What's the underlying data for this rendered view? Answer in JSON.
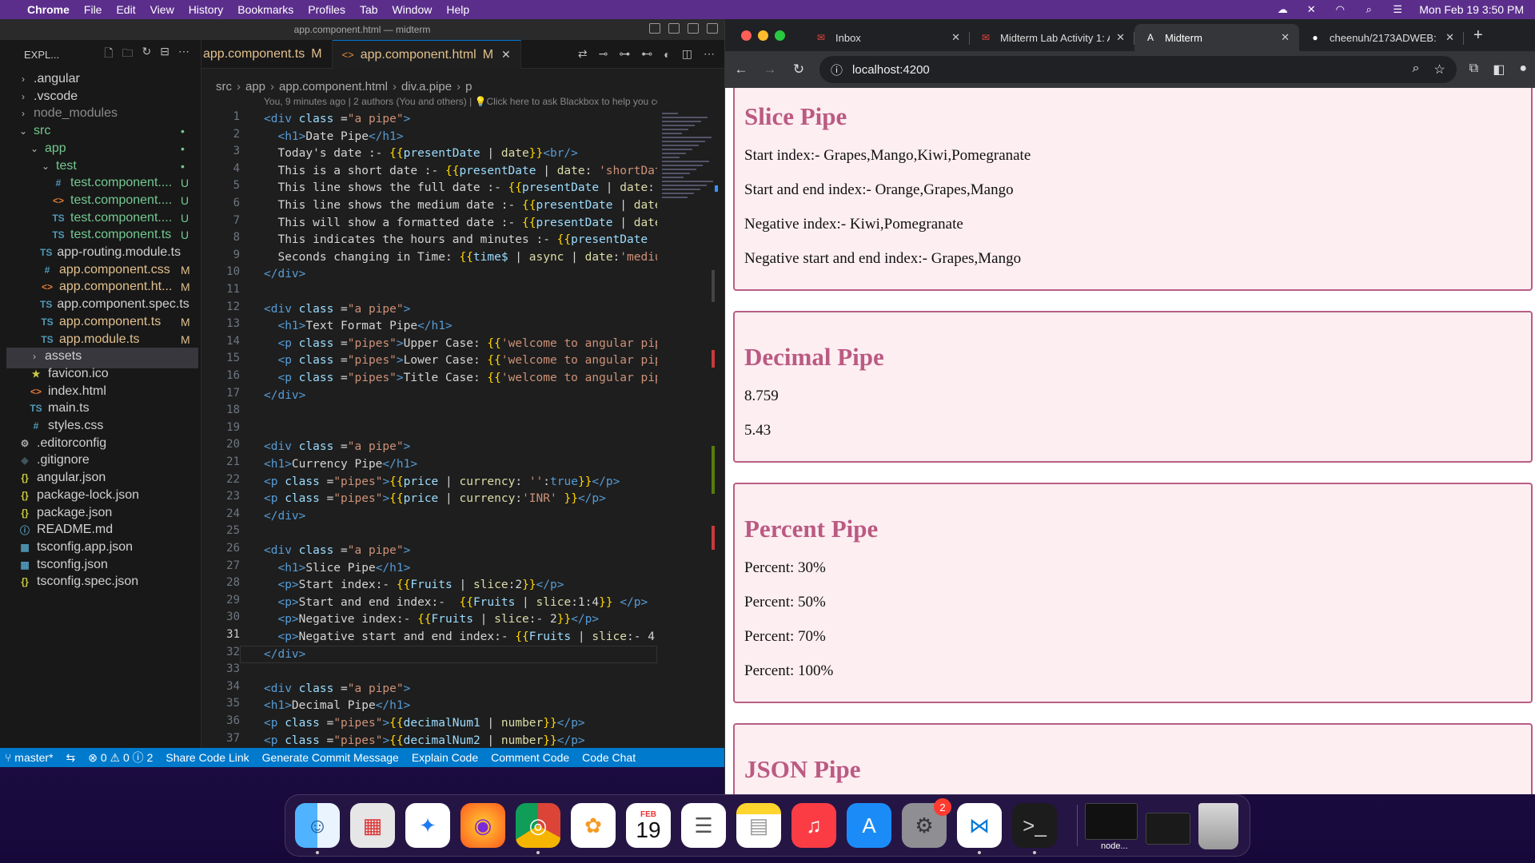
{
  "menubar": {
    "app": "Chrome",
    "items": [
      "File",
      "Edit",
      "View",
      "History",
      "Bookmarks",
      "Profiles",
      "Tab",
      "Window",
      "Help"
    ],
    "datetime": "Mon Feb 19  3:50 PM"
  },
  "vscode": {
    "window_title": "app.component.html — midterm",
    "explorer_label": "EXPL...",
    "tree": [
      {
        "label": ".angular",
        "type": "folder",
        "indent": 1,
        "expanded": false,
        "status": ""
      },
      {
        "label": ".vscode",
        "type": "folder",
        "indent": 1,
        "expanded": false,
        "status": ""
      },
      {
        "label": "node_modules",
        "type": "folder",
        "indent": 1,
        "expanded": false,
        "status": "",
        "dim": true
      },
      {
        "label": "src",
        "type": "folder",
        "indent": 1,
        "expanded": true,
        "status": "•",
        "color": "untracked"
      },
      {
        "label": "app",
        "type": "folder",
        "indent": 2,
        "expanded": true,
        "status": "•",
        "color": "untracked"
      },
      {
        "label": "test",
        "type": "folder",
        "indent": 3,
        "expanded": true,
        "status": "•",
        "color": "untracked"
      },
      {
        "label": "test.component....",
        "type": "css",
        "indent": 4,
        "status": "U",
        "color": "untracked"
      },
      {
        "label": "test.component....",
        "type": "html",
        "indent": 4,
        "status": "U",
        "color": "untracked"
      },
      {
        "label": "test.component....",
        "type": "ts",
        "indent": 4,
        "status": "U",
        "color": "untracked"
      },
      {
        "label": "test.component.ts",
        "type": "ts",
        "indent": 4,
        "status": "U",
        "color": "untracked"
      },
      {
        "label": "app-routing.module.ts",
        "type": "ts",
        "indent": 3,
        "status": ""
      },
      {
        "label": "app.component.css",
        "type": "css",
        "indent": 3,
        "status": "M",
        "color": "modified"
      },
      {
        "label": "app.component.ht...",
        "type": "html",
        "indent": 3,
        "status": "M",
        "color": "modified"
      },
      {
        "label": "app.component.spec.ts",
        "type": "ts",
        "indent": 3,
        "status": ""
      },
      {
        "label": "app.component.ts",
        "type": "ts",
        "indent": 3,
        "status": "M",
        "color": "modified"
      },
      {
        "label": "app.module.ts",
        "type": "ts",
        "indent": 3,
        "status": "M",
        "color": "modified"
      },
      {
        "label": "assets",
        "type": "folder",
        "indent": 2,
        "expanded": false,
        "status": ""
      },
      {
        "label": "favicon.ico",
        "type": "star",
        "indent": 2,
        "status": ""
      },
      {
        "label": "index.html",
        "type": "html",
        "indent": 2,
        "status": ""
      },
      {
        "label": "main.ts",
        "type": "ts",
        "indent": 2,
        "status": ""
      },
      {
        "label": "styles.css",
        "type": "css",
        "indent": 2,
        "status": ""
      },
      {
        "label": ".editorconfig",
        "type": "gear",
        "indent": 1,
        "status": ""
      },
      {
        "label": ".gitignore",
        "type": "git",
        "indent": 1,
        "status": ""
      },
      {
        "label": "angular.json",
        "type": "json",
        "indent": 1,
        "status": ""
      },
      {
        "label": "package-lock.json",
        "type": "json",
        "indent": 1,
        "status": ""
      },
      {
        "label": "package.json",
        "type": "json",
        "indent": 1,
        "status": ""
      },
      {
        "label": "README.md",
        "type": "info",
        "indent": 1,
        "status": ""
      },
      {
        "label": "tsconfig.app.json",
        "type": "tsc",
        "indent": 1,
        "status": ""
      },
      {
        "label": "tsconfig.json",
        "type": "tsc",
        "indent": 1,
        "status": ""
      },
      {
        "label": "tsconfig.spec.json",
        "type": "json",
        "indent": 1,
        "status": ""
      }
    ],
    "tabs": [
      {
        "label": "app.component.ts",
        "status": "M",
        "icon": ""
      },
      {
        "label": "app.component.html",
        "status": "M",
        "icon": "<>",
        "active": true
      }
    ],
    "breadcrumb": [
      "src",
      "app",
      "app.component.html",
      "div.a.pipe",
      "p"
    ],
    "blame": "You, 9 minutes ago | 2 authors (You and others) | 💡Click here to ask Blackbox to help you code faster",
    "current_line": 31,
    "code_lines": [
      [
        [
          "tg",
          "<div"
        ],
        [
          "at",
          " class"
        ],
        [
          "tx",
          " ="
        ],
        [
          "sv",
          "\"a pipe\""
        ],
        [
          "tg",
          ">"
        ]
      ],
      [
        [
          "tx",
          "  "
        ],
        [
          "tg",
          "<h1>"
        ],
        [
          "tx",
          "Date Pipe"
        ],
        [
          "tg",
          "</h1>"
        ]
      ],
      [
        [
          "tx",
          "  Today's date :- "
        ],
        [
          "br",
          "{{"
        ],
        [
          "pv",
          "presentDate"
        ],
        [
          "tx",
          " | "
        ],
        [
          "kw",
          "date"
        ],
        [
          "br",
          "}}"
        ],
        [
          "tg",
          "<br/>"
        ]
      ],
      [
        [
          "tx",
          "  This is a short date :- "
        ],
        [
          "br",
          "{{"
        ],
        [
          "pv",
          "presentDate"
        ],
        [
          "tx",
          " | "
        ],
        [
          "kw",
          "date"
        ],
        [
          "tx",
          ": "
        ],
        [
          "sv",
          "'shortDate'"
        ]
      ],
      [
        [
          "tx",
          "  This line shows the full date :- "
        ],
        [
          "br",
          "{{"
        ],
        [
          "pv",
          "presentDate"
        ],
        [
          "tx",
          " | "
        ],
        [
          "kw",
          "date"
        ],
        [
          "tx",
          ": "
        ],
        [
          "sv",
          "'fullDate'"
        ]
      ],
      [
        [
          "tx",
          "  This line shows the medium date :- "
        ],
        [
          "br",
          "{{"
        ],
        [
          "pv",
          "presentDate"
        ],
        [
          "tx",
          " | "
        ],
        [
          "kw",
          "date"
        ]
      ],
      [
        [
          "tx",
          "  This will show a formatted date :- "
        ],
        [
          "br",
          "{{"
        ],
        [
          "pv",
          "presentDate"
        ],
        [
          "tx",
          " | "
        ],
        [
          "kw",
          "date"
        ]
      ],
      [
        [
          "tx",
          "  This indicates the hours and minutes :- "
        ],
        [
          "br",
          "{{"
        ],
        [
          "pv",
          "presentDate"
        ],
        [
          "tx",
          " |"
        ]
      ],
      [
        [
          "tx",
          "  Seconds changing in Time: "
        ],
        [
          "br",
          "{{"
        ],
        [
          "pv",
          "time$"
        ],
        [
          "tx",
          " | "
        ],
        [
          "kw",
          "async"
        ],
        [
          "tx",
          " | "
        ],
        [
          "kw",
          "date"
        ],
        [
          "tx",
          ":"
        ],
        [
          "sv",
          "'medium'"
        ]
      ],
      [
        [
          "tg",
          "</div>"
        ]
      ],
      [
        [
          "tx",
          ""
        ]
      ],
      [
        [
          "tg",
          "<div"
        ],
        [
          "at",
          " class"
        ],
        [
          "tx",
          " ="
        ],
        [
          "sv",
          "\"a pipe\""
        ],
        [
          "tg",
          ">"
        ]
      ],
      [
        [
          "tx",
          "  "
        ],
        [
          "tg",
          "<h1>"
        ],
        [
          "tx",
          "Text Format Pipe"
        ],
        [
          "tg",
          "</h1>"
        ]
      ],
      [
        [
          "tx",
          "  "
        ],
        [
          "tg",
          "<p"
        ],
        [
          "at",
          " class"
        ],
        [
          "tx",
          " ="
        ],
        [
          "sv",
          "\"pipes\""
        ],
        [
          "tg",
          ">"
        ],
        [
          "tx",
          "Upper Case: "
        ],
        [
          "br",
          "{{"
        ],
        [
          "sv",
          "'welcome to angular pipes'"
        ]
      ],
      [
        [
          "tx",
          "  "
        ],
        [
          "tg",
          "<p"
        ],
        [
          "at",
          " class"
        ],
        [
          "tx",
          " ="
        ],
        [
          "sv",
          "\"pipes\""
        ],
        [
          "tg",
          ">"
        ],
        [
          "tx",
          "Lower Case: "
        ],
        [
          "br",
          "{{"
        ],
        [
          "sv",
          "'welcome to angular pipes'"
        ]
      ],
      [
        [
          "tx",
          "  "
        ],
        [
          "tg",
          "<p"
        ],
        [
          "at",
          " class"
        ],
        [
          "tx",
          " ="
        ],
        [
          "sv",
          "\"pipes\""
        ],
        [
          "tg",
          ">"
        ],
        [
          "tx",
          "Title Case: "
        ],
        [
          "br",
          "{{"
        ],
        [
          "sv",
          "'welcome to angular pipes'"
        ]
      ],
      [
        [
          "tg",
          "</div>"
        ]
      ],
      [
        [
          "tx",
          ""
        ]
      ],
      [
        [
          "tx",
          ""
        ]
      ],
      [
        [
          "tg",
          "<div"
        ],
        [
          "at",
          " class"
        ],
        [
          "tx",
          " ="
        ],
        [
          "sv",
          "\"a pipe\""
        ],
        [
          "tg",
          ">"
        ]
      ],
      [
        [
          "tg",
          "<h1>"
        ],
        [
          "tx",
          "Currency Pipe"
        ],
        [
          "tg",
          "</h1>"
        ]
      ],
      [
        [
          "tg",
          "<p"
        ],
        [
          "at",
          " class"
        ],
        [
          "tx",
          " ="
        ],
        [
          "sv",
          "\"pipes\""
        ],
        [
          "tg",
          ">"
        ],
        [
          "br",
          "{{"
        ],
        [
          "pv",
          "price"
        ],
        [
          "tx",
          " | "
        ],
        [
          "kw",
          "currency"
        ],
        [
          "tx",
          ": "
        ],
        [
          "sv",
          "''"
        ],
        [
          "tx",
          ":"
        ],
        [
          "tg",
          "true"
        ],
        [
          "br",
          "}}"
        ],
        [
          "tg",
          "</p>"
        ]
      ],
      [
        [
          "tg",
          "<p"
        ],
        [
          "at",
          " class"
        ],
        [
          "tx",
          " ="
        ],
        [
          "sv",
          "\"pipes\""
        ],
        [
          "tg",
          ">"
        ],
        [
          "br",
          "{{"
        ],
        [
          "pv",
          "price"
        ],
        [
          "tx",
          " | "
        ],
        [
          "kw",
          "currency"
        ],
        [
          "tx",
          ":"
        ],
        [
          "sv",
          "'INR'"
        ],
        [
          "tx",
          " "
        ],
        [
          "br",
          "}}"
        ],
        [
          "tg",
          "</p>"
        ]
      ],
      [
        [
          "tg",
          "</div>"
        ]
      ],
      [
        [
          "tx",
          ""
        ]
      ],
      [
        [
          "tg",
          "<div"
        ],
        [
          "at",
          " class"
        ],
        [
          "tx",
          " ="
        ],
        [
          "sv",
          "\"a pipe\""
        ],
        [
          "tg",
          ">"
        ]
      ],
      [
        [
          "tx",
          "  "
        ],
        [
          "tg",
          "<h1>"
        ],
        [
          "tx",
          "Slice Pipe"
        ],
        [
          "tg",
          "</h1>"
        ]
      ],
      [
        [
          "tx",
          "  "
        ],
        [
          "tg",
          "<p>"
        ],
        [
          "tx",
          "Start index:- "
        ],
        [
          "br",
          "{{"
        ],
        [
          "pv",
          "Fruits"
        ],
        [
          "tx",
          " | "
        ],
        [
          "kw",
          "slice"
        ],
        [
          "tx",
          ":2"
        ],
        [
          "br",
          "}}"
        ],
        [
          "tg",
          "</p>"
        ]
      ],
      [
        [
          "tx",
          "  "
        ],
        [
          "tg",
          "<p>"
        ],
        [
          "tx",
          "Start and end index:-  "
        ],
        [
          "br",
          "{{"
        ],
        [
          "pv",
          "Fruits"
        ],
        [
          "tx",
          " | "
        ],
        [
          "kw",
          "slice"
        ],
        [
          "tx",
          ":1:4"
        ],
        [
          "br",
          "}}"
        ],
        [
          "tx",
          " "
        ],
        [
          "tg",
          "</p>"
        ]
      ],
      [
        [
          "tx",
          "  "
        ],
        [
          "tg",
          "<p>"
        ],
        [
          "tx",
          "Negative index:- "
        ],
        [
          "br",
          "{{"
        ],
        [
          "pv",
          "Fruits"
        ],
        [
          "tx",
          " | "
        ],
        [
          "kw",
          "slice"
        ],
        [
          "tx",
          ":- 2"
        ],
        [
          "br",
          "}}"
        ],
        [
          "tg",
          "</p>"
        ]
      ],
      [
        [
          "tx",
          "  "
        ],
        [
          "tg",
          "<p>"
        ],
        [
          "tx",
          "Negative start and end index:- "
        ],
        [
          "br",
          "{{"
        ],
        [
          "pv",
          "Fruits"
        ],
        [
          "tx",
          " | "
        ],
        [
          "kw",
          "slice"
        ],
        [
          "tx",
          ":- 4:"
        ]
      ],
      [
        [
          "tg",
          "</div>"
        ]
      ],
      [
        [
          "tx",
          ""
        ]
      ],
      [
        [
          "tg",
          "<div"
        ],
        [
          "at",
          " class"
        ],
        [
          "tx",
          " ="
        ],
        [
          "sv",
          "\"a pipe\""
        ],
        [
          "tg",
          ">"
        ]
      ],
      [
        [
          "tg",
          "<h1>"
        ],
        [
          "tx",
          "Decimal Pipe"
        ],
        [
          "tg",
          "</h1>"
        ]
      ],
      [
        [
          "tg",
          "<p"
        ],
        [
          "at",
          " class"
        ],
        [
          "tx",
          " ="
        ],
        [
          "sv",
          "\"pipes\""
        ],
        [
          "tg",
          ">"
        ],
        [
          "br",
          "{{"
        ],
        [
          "pv",
          "decimalNum1"
        ],
        [
          "tx",
          " | "
        ],
        [
          "kw",
          "number"
        ],
        [
          "br",
          "}}"
        ],
        [
          "tg",
          "</p>"
        ]
      ],
      [
        [
          "tg",
          "<p"
        ],
        [
          "at",
          " class"
        ],
        [
          "tx",
          " ="
        ],
        [
          "sv",
          "\"pipes\""
        ],
        [
          "tg",
          ">"
        ],
        [
          "br",
          "{{"
        ],
        [
          "pv",
          "decimalNum2"
        ],
        [
          "tx",
          " | "
        ],
        [
          "kw",
          "number"
        ],
        [
          "br",
          "}}"
        ],
        [
          "tg",
          "</p>"
        ]
      ]
    ],
    "status": {
      "branch": "master*",
      "problems": "⊗ 0 ⚠ 0 ⓘ 2",
      "actions": [
        "Share Code Link",
        "Generate Commit Message",
        "Explain Code",
        "Comment Code",
        "Code Chat"
      ]
    }
  },
  "chrome": {
    "tabs": [
      {
        "label": "Inbox",
        "icon": "inbox-icon"
      },
      {
        "label": "Midterm Lab Activity 1: A",
        "icon": "classroom-icon"
      },
      {
        "label": "Midterm",
        "icon": "angular-icon",
        "active": true
      },
      {
        "label": "cheenuh/2173ADWEB: a",
        "icon": "github-icon"
      }
    ],
    "url": "localhost:4200",
    "cards": [
      {
        "title": "Slice Pipe",
        "lines": [
          "Start index:- Grapes,Mango,Kiwi,Pomegranate",
          "Start and end index:- Orange,Grapes,Mango",
          "Negative index:- Kiwi,Pomegranate",
          "Negative start and end index:- Grapes,Mango"
        ]
      },
      {
        "title": "Decimal Pipe",
        "lines": [
          "8.759",
          "5.43"
        ]
      },
      {
        "title": "Percent Pipe",
        "lines": [
          "Percent: 30%",
          "Percent: 50%",
          "Percent: 70%",
          "Percent: 100%"
        ]
      },
      {
        "title": "JSON Pipe",
        "lines": []
      }
    ]
  },
  "dock": {
    "items": [
      {
        "name": "finder-icon",
        "running": true
      },
      {
        "name": "launchpad-icon"
      },
      {
        "name": "safari-icon"
      },
      {
        "name": "firefox-icon"
      },
      {
        "name": "chrome-icon",
        "running": true
      },
      {
        "name": "photos-icon"
      },
      {
        "name": "calendar-icon",
        "month": "FEB",
        "day": "19"
      },
      {
        "name": "reminders-icon"
      },
      {
        "name": "notes-icon"
      },
      {
        "name": "music-icon"
      },
      {
        "name": "app-store-icon"
      },
      {
        "name": "system-settings-icon",
        "badge": "2"
      },
      {
        "name": "vscode-icon",
        "running": true
      },
      {
        "name": "terminal-icon",
        "running": true
      }
    ],
    "minimized_label": "node..."
  }
}
